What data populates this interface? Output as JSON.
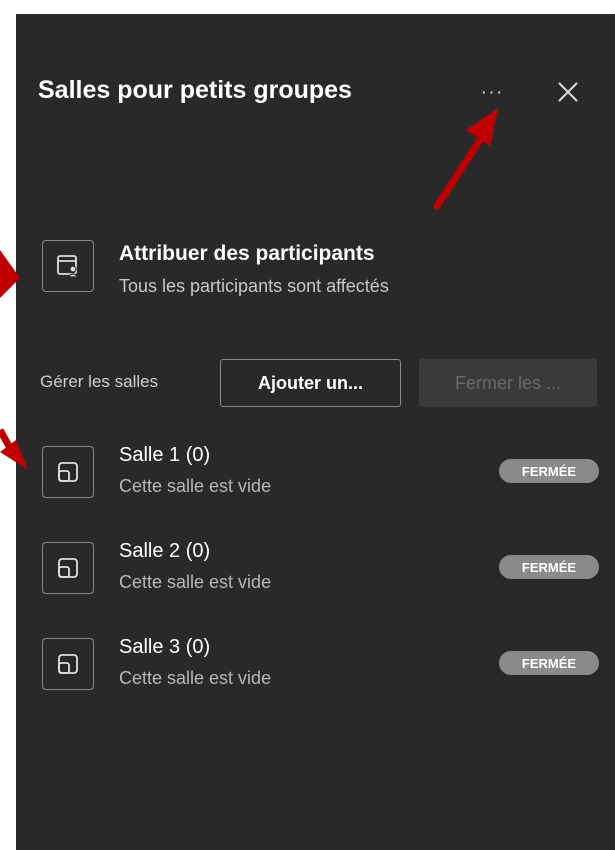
{
  "header": {
    "title": "Salles pour petits groupes",
    "more_icon": "more-options-icon",
    "more_text": "···",
    "close_icon": "close-icon"
  },
  "assign": {
    "title": "Attribuer des participants",
    "subtitle": "Tous les participants sont affectés",
    "icon": "assign-participants-icon"
  },
  "manage": {
    "label": "Gérer les salles",
    "add_button": "Ajouter un...",
    "close_button": "Fermer les ..."
  },
  "rooms": [
    {
      "title": "Salle 1 (0)",
      "subtitle": "Cette salle est vide",
      "status": "FERMÉE"
    },
    {
      "title": "Salle 2 (0)",
      "subtitle": "Cette salle est vide",
      "status": "FERMÉE"
    },
    {
      "title": "Salle 3 (0)",
      "subtitle": "Cette salle est vide",
      "status": "FERMÉE"
    }
  ],
  "colors": {
    "panel_bg": "#292929",
    "annotation_arrow": "#c00000",
    "badge_bg": "#8a8a8a"
  }
}
